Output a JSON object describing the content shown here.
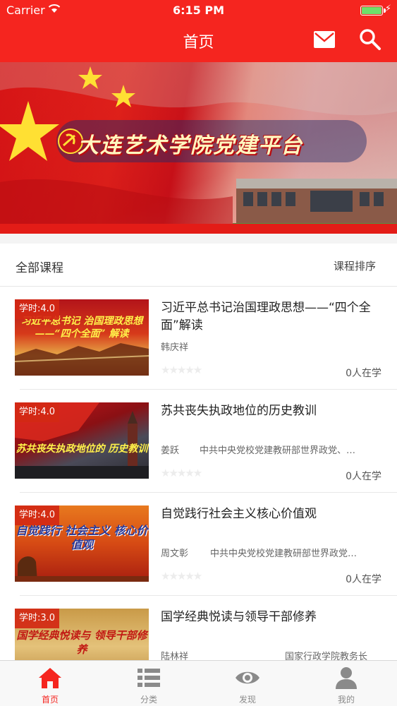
{
  "status_bar": {
    "carrier": "Carrier",
    "time": "6:15 PM"
  },
  "header": {
    "title": "首页",
    "mail_icon": "mail-icon",
    "search_icon": "search-icon"
  },
  "banner": {
    "title": "大连艺术学院党建平台"
  },
  "course_list": {
    "heading": "全部课程",
    "sort_label": "课程排序",
    "courses": [
      {
        "hours": "学时:4.0",
        "thumb_text": "习近平总书记 治国理政思想 ——“四个全面” 解读",
        "title": "习近平总书记治国理政思想——“四个全面”解读",
        "author": "韩庆祥",
        "org": "",
        "rating": 0,
        "learners": "0人在学"
      },
      {
        "hours": "学时:4.0",
        "thumb_text": "苏共丧失执政地位的 历史教训",
        "title": "苏共丧失执政地位的历史教训",
        "author": "姜跃",
        "org": "中共中央党校党建教研部世界政党、…",
        "rating": 0,
        "learners": "0人在学"
      },
      {
        "hours": "学时:4.0",
        "thumb_text": "自觉践行 社会主义 核心价值观",
        "title": "自觉践行社会主义核心价值观",
        "author": "周文彰",
        "org": "中共中央党校党建教研部世界政党…",
        "rating": 0,
        "learners": "0人在学"
      },
      {
        "hours": "学时:3.0",
        "thumb_text": "国学经典悦读与 领导干部修养",
        "title": "国学经典悦读与领导干部修养",
        "author": "陆林祥",
        "org": "国家行政学院教务长",
        "rating": 0,
        "learners": ""
      }
    ]
  },
  "tabbar": {
    "tabs": [
      {
        "label": "首页",
        "icon": "home-icon",
        "active": true
      },
      {
        "label": "分类",
        "icon": "list-icon",
        "active": false
      },
      {
        "label": "发现",
        "icon": "eye-icon",
        "active": false
      },
      {
        "label": "我的",
        "icon": "person-icon",
        "active": false
      }
    ]
  },
  "colors": {
    "brand_red": "#f5251f",
    "inactive_gray": "#8a8a8a"
  }
}
